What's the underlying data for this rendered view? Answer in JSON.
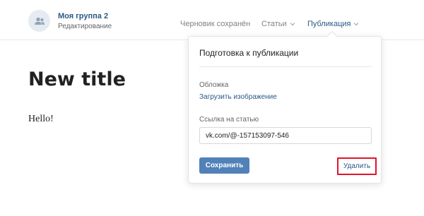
{
  "header": {
    "group_name": "Моя группа 2",
    "group_subtitle": "Редактирование",
    "draft_status": "Черновик сохранён",
    "nav": {
      "articles": "Статьи",
      "publish": "Публикация"
    }
  },
  "article": {
    "title": "New title",
    "body": "Hello!"
  },
  "publish_popup": {
    "title": "Подготовка к публикации",
    "cover_label": "Обложка",
    "cover_link": "Загрузить изображение",
    "link_label": "Ссылка на статью",
    "link_value": "vk.com/@-157153097-546",
    "save_label": "Сохранить",
    "delete_label": "Удалить"
  },
  "colors": {
    "accent_link": "#2a5885",
    "button_primary": "#5181b8",
    "highlight_border": "#e0142b"
  },
  "icons": {
    "avatar": "group-icon",
    "dropdown": "chevron-down-icon"
  }
}
